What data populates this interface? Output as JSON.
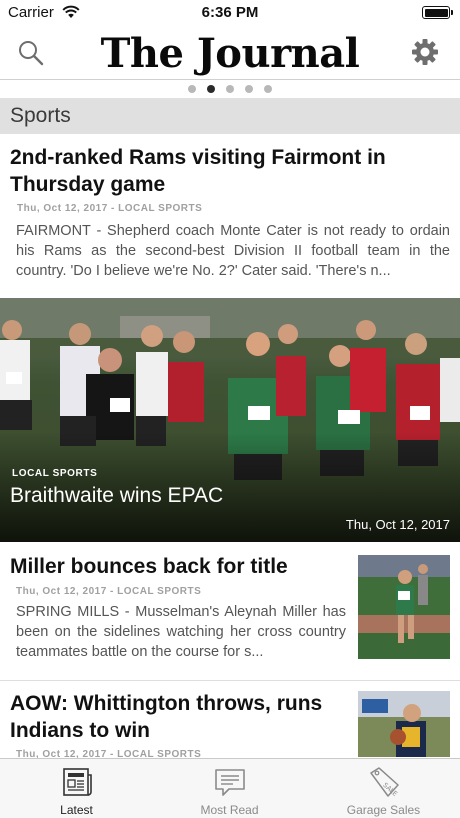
{
  "status_bar": {
    "carrier": "Carrier",
    "time": "6:36 PM"
  },
  "header": {
    "masthead": "The Journal",
    "search_icon": "search-icon",
    "settings_icon": "gear-icon"
  },
  "pager": {
    "count": 5,
    "active_index": 1
  },
  "section": {
    "title": "Sports"
  },
  "articles": [
    {
      "headline": "2nd-ranked Rams visiting Fairmont in Thursday game",
      "meta": "Thu, Oct 12, 2017 - LOCAL SPORTS",
      "summary": "FAIRMONT - Shepherd coach Monte Cater is not ready to ordain his Rams as the second-best Division II football team in the country. 'Do I believe we're No. 2?' Cater said. 'There's n..."
    },
    {
      "category": "LOCAL SPORTS",
      "headline": "Braithwaite wins EPAC",
      "date": "Thu, Oct 12, 2017"
    },
    {
      "headline": "Miller bounces back for title",
      "meta": "Thu, Oct 12, 2017 - LOCAL SPORTS",
      "summary": "SPRING MILLS - Musselman's Aleynah Miller has been on the sidelines watching her cross country teammates battle on the course for s..."
    },
    {
      "headline": "AOW: Whittington throws, runs Indians to win",
      "meta": "Thu, Oct 12, 2017 - LOCAL SPORTS"
    }
  ],
  "tab_bar": {
    "tabs": [
      {
        "label": "Latest",
        "icon": "newspaper-icon",
        "active": true
      },
      {
        "label": "Most Read",
        "icon": "chat-bubble-icon",
        "active": false
      },
      {
        "label": "Garage Sales",
        "icon": "sale-tag-icon",
        "active": false
      }
    ]
  }
}
